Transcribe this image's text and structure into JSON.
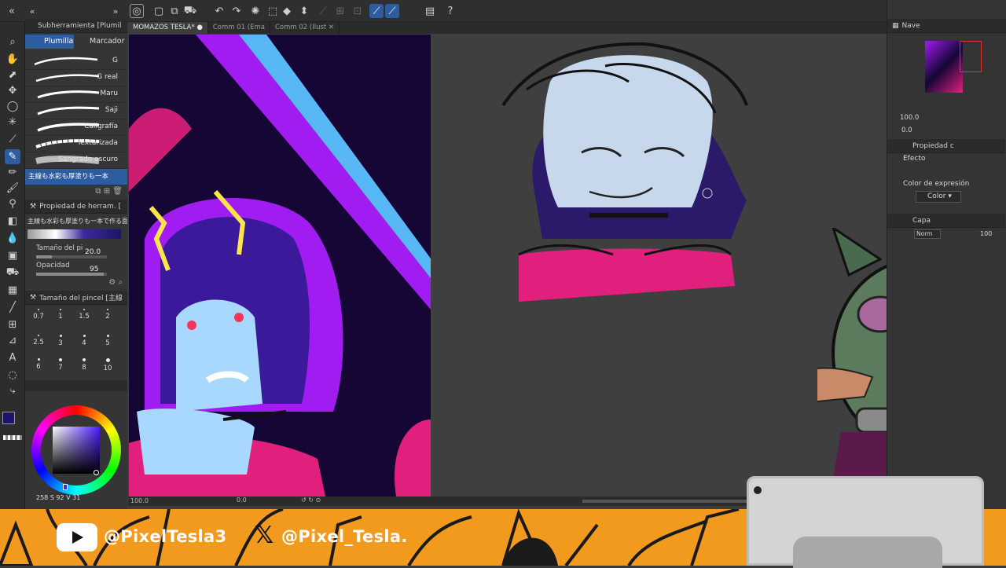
{
  "top_toolbar": {
    "icons": [
      "clip-icon",
      "new-layer-icon",
      "copy-icon",
      "fill-icon",
      "undo-icon",
      "redo-icon",
      "transform-icon",
      "select-icon",
      "ruler-icon",
      "pen-mode-icon",
      "grid-icon",
      "help-icon"
    ]
  },
  "sub_tool": {
    "panel_title": "Subherramienta [Plumil",
    "tabs": [
      "Plumilla",
      "Marcador"
    ],
    "brushes": [
      "G",
      "G real",
      "Maru",
      "Saji",
      "Caligrafía",
      "Texturizada",
      "Sangrado oscuro"
    ],
    "selected_brush": "主線も水彩も厚塗りも一本"
  },
  "tool_property": {
    "title": "Propiedad de herram. [",
    "brush_name": "主線も水彩も厚塗りも一本で作る面倒",
    "brush_size_label": "Tamaño del pi",
    "brush_size_value": "20.0",
    "opacity_label": "Opacidad",
    "opacity_value": "95"
  },
  "brush_size_panel": {
    "title": "Tamaño del pincel [主線",
    "sizes": [
      "0.7",
      "1",
      "1.5",
      "2",
      "2.5",
      "3",
      "4",
      "5",
      "6",
      "7",
      "8",
      "10"
    ]
  },
  "color": {
    "main": "#1c1468",
    "sub": "#ffffff",
    "hsv_text": "258 S 92 V 31"
  },
  "document_tabs": [
    {
      "label": "MOMAZOS TESLA*",
      "active": true
    },
    {
      "label": "Comm 01 (Ema",
      "active": false
    },
    {
      "label": "Comm 02 (Ilust",
      "active": false
    }
  ],
  "status": {
    "zoom": "100.0",
    "angle": "0.0"
  },
  "navigator": {
    "title": "Nave",
    "zoom": "100.0",
    "angle": "0.0"
  },
  "layer_property": {
    "title": "Propiedad c",
    "effect_label": "Efecto",
    "expression_label": "Color de expresión",
    "expression_value": "Color"
  },
  "layer_panel": {
    "title": "Capa",
    "blend_mode": "Norm",
    "opacity": "100"
  },
  "banner": {
    "youtube_handle": "@PixelTesla3",
    "x_handle": "@Pixel_Tesla.",
    "bg_color": "#f29a1e"
  }
}
